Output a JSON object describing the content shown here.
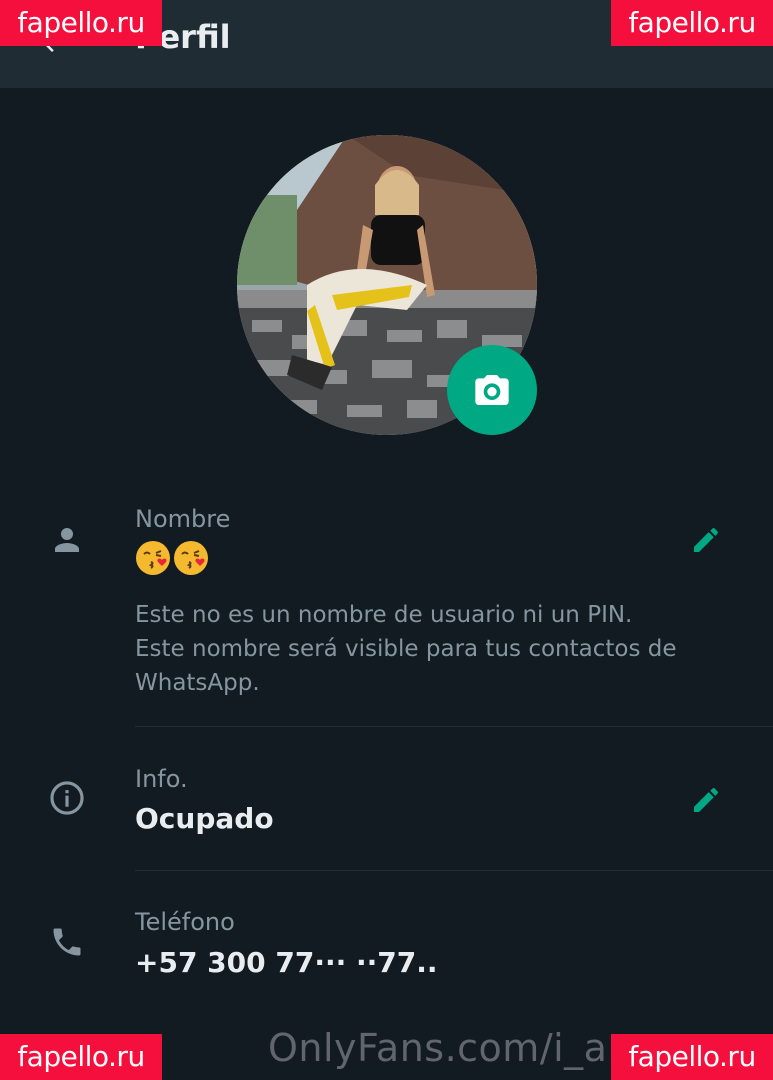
{
  "appbar": {
    "title": "Perfil"
  },
  "watermarks": {
    "corner": "fapello.ru",
    "footer": "OnlyFans.com/i_an...a"
  },
  "profile": {
    "name": {
      "label": "Nombre",
      "emoji": [
        "kissing-face-with-heart",
        "kissing-face-with-heart"
      ],
      "hint_line1": "Este no es un nombre de usuario ni un PIN.",
      "hint_line2": "Este nombre será visible para tus contactos de",
      "hint_line3": "WhatsApp."
    },
    "info": {
      "label": "Info.",
      "value": "Ocupado"
    },
    "phone": {
      "label": "Teléfono",
      "value": "+57 300 77··· ··77.."
    }
  },
  "colors": {
    "background": "#121b22",
    "appbar": "#1f2c34",
    "accent": "#00a884",
    "secondary_text": "#8696a0",
    "watermark": "#f40f3c"
  },
  "icons": [
    "back-arrow-icon",
    "camera-icon",
    "person-icon",
    "info-icon",
    "phone-icon",
    "pencil-icon"
  ]
}
